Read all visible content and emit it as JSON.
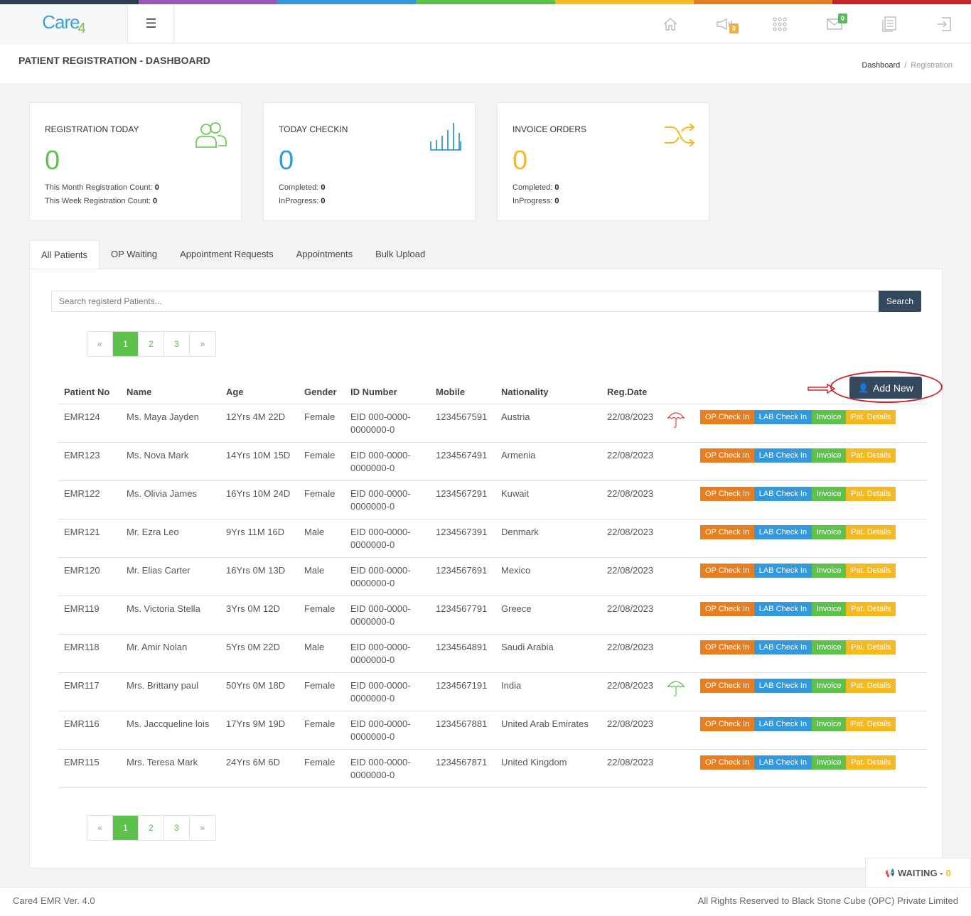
{
  "brand": {
    "logo_main": "Care",
    "logo_sub": "4",
    "strip_colors": [
      "#2c3e50",
      "#9b59b6",
      "#3498db",
      "#5cc24a",
      "#f5b921",
      "#e67e22",
      "#c9232b"
    ]
  },
  "topbar": {
    "icons": [
      "home-icon",
      "megaphone-icon",
      "apps-grid-icon",
      "mail-icon",
      "report-icon",
      "logout-icon"
    ],
    "announcement_badge": "0",
    "mail_badge": "0"
  },
  "header": {
    "title": "PATIENT REGISTRATION - DASHBOARD",
    "breadcrumb": [
      "Dashboard",
      "Registration"
    ]
  },
  "stats": [
    {
      "label": "REGISTRATION TODAY",
      "value": "0",
      "color": "#5cc24a",
      "line1_label": "This Month Registration Count:",
      "line1_value": "0",
      "line2_label": "This Week Registration Count:",
      "line2_value": "0"
    },
    {
      "label": "TODAY CHECKIN",
      "value": "0",
      "color": "#3498db",
      "line1_label": "Completed:",
      "line1_value": "0",
      "line2_label": "InProgress:",
      "line2_value": "0"
    },
    {
      "label": "INVOICE ORDERS",
      "value": "0",
      "color": "#f5b921",
      "line1_label": "Completed:",
      "line1_value": "0",
      "line2_label": "InProgress:",
      "line2_value": "0"
    }
  ],
  "tabs": [
    "All Patients",
    "OP Waiting",
    "Appointment Requests",
    "Appointments",
    "Bulk Upload"
  ],
  "search": {
    "placeholder": "Search registerd Patients...",
    "button": "Search"
  },
  "pagination": {
    "prev": "«",
    "pages": [
      "1",
      "2",
      "3"
    ],
    "next": "»",
    "current": "1"
  },
  "add_new": "Add New",
  "table": {
    "columns": [
      "Patient No",
      "Name",
      "Age",
      "Gender",
      "ID Number",
      "Mobile",
      "Nationality",
      "Reg.Date"
    ],
    "actions": [
      "OP Check In",
      "LAB Check In",
      "Invoice",
      "Pat. Details"
    ],
    "rows": [
      {
        "no": "EMR124",
        "name": "Ms. Maya Jayden",
        "age": "12Yrs 4M 22D",
        "gender": "Female",
        "id1": "EID 000-0000-",
        "id2": "0000000-0",
        "mobile": "1234567591",
        "nationality": "Austria",
        "date": "22/08/2023",
        "umbrella": "red"
      },
      {
        "no": "EMR123",
        "name": "Ms. Nova Mark",
        "age": "14Yrs 10M 15D",
        "gender": "Female",
        "id1": "EID 000-0000-",
        "id2": "0000000-0",
        "mobile": "1234567491",
        "nationality": "Armenia",
        "date": "22/08/2023",
        "umbrella": ""
      },
      {
        "no": "EMR122",
        "name": "Ms. Olivia James",
        "age": "16Yrs 10M 24D",
        "gender": "Female",
        "id1": "EID 000-0000-",
        "id2": "0000000-0",
        "mobile": "1234567291",
        "nationality": "Kuwait",
        "date": "22/08/2023",
        "umbrella": ""
      },
      {
        "no": "EMR121",
        "name": "Mr. Ezra Leo",
        "age": "9Yrs 11M 16D",
        "gender": "Male",
        "id1": "EID 000-0000-",
        "id2": "0000000-0",
        "mobile": "1234567391",
        "nationality": "Denmark",
        "date": "22/08/2023",
        "umbrella": ""
      },
      {
        "no": "EMR120",
        "name": "Mr. Elias Carter",
        "age": "16Yrs 0M 13D",
        "gender": "Male",
        "id1": "EID 000-0000-",
        "id2": "0000000-0",
        "mobile": "1234567691",
        "nationality": "Mexico",
        "date": "22/08/2023",
        "umbrella": ""
      },
      {
        "no": "EMR119",
        "name": "Ms. Victoria Stella",
        "age": "3Yrs 0M 12D",
        "gender": "Female",
        "id1": "EID 000-0000-",
        "id2": "0000000-0",
        "mobile": "1234567791",
        "nationality": "Greece",
        "date": "22/08/2023",
        "umbrella": ""
      },
      {
        "no": "EMR118",
        "name": "Mr. Amir Nolan",
        "age": "5Yrs 0M 22D",
        "gender": "Male",
        "id1": "EID 000-0000-",
        "id2": "0000000-0",
        "mobile": "1234564891",
        "nationality": "Saudi Arabia",
        "date": "22/08/2023",
        "umbrella": ""
      },
      {
        "no": "EMR117",
        "name": "Mrs. Brittany paul",
        "age": "50Yrs 0M 18D",
        "gender": "Female",
        "id1": "EID 000-0000-",
        "id2": "0000000-0",
        "mobile": "1234567191",
        "nationality": "India",
        "date": "22/08/2023",
        "umbrella": "green"
      },
      {
        "no": "EMR116",
        "name": "Ms. Jaccqueline lois",
        "age": "17Yrs 9M 19D",
        "gender": "Female",
        "id1": "EID 000-0000-",
        "id2": "0000000-0",
        "mobile": "1234567881",
        "nationality": "United Arab Emirates",
        "date": "22/08/2023",
        "umbrella": ""
      },
      {
        "no": "EMR115",
        "name": "Mrs. Teresa Mark",
        "age": "24Yrs 6M 6D",
        "gender": "Female",
        "id1": "EID 000-0000-",
        "id2": "0000000-0",
        "mobile": "1234567871",
        "nationality": "United Kingdom",
        "date": "22/08/2023",
        "umbrella": ""
      }
    ]
  },
  "waiting": {
    "label": "WAITING -",
    "count": "0"
  },
  "footer": {
    "version": "Care4 EMR Ver. 4.0",
    "rights": "All Rights Reserved to Black Stone Cube (OPC) Private Limited"
  }
}
